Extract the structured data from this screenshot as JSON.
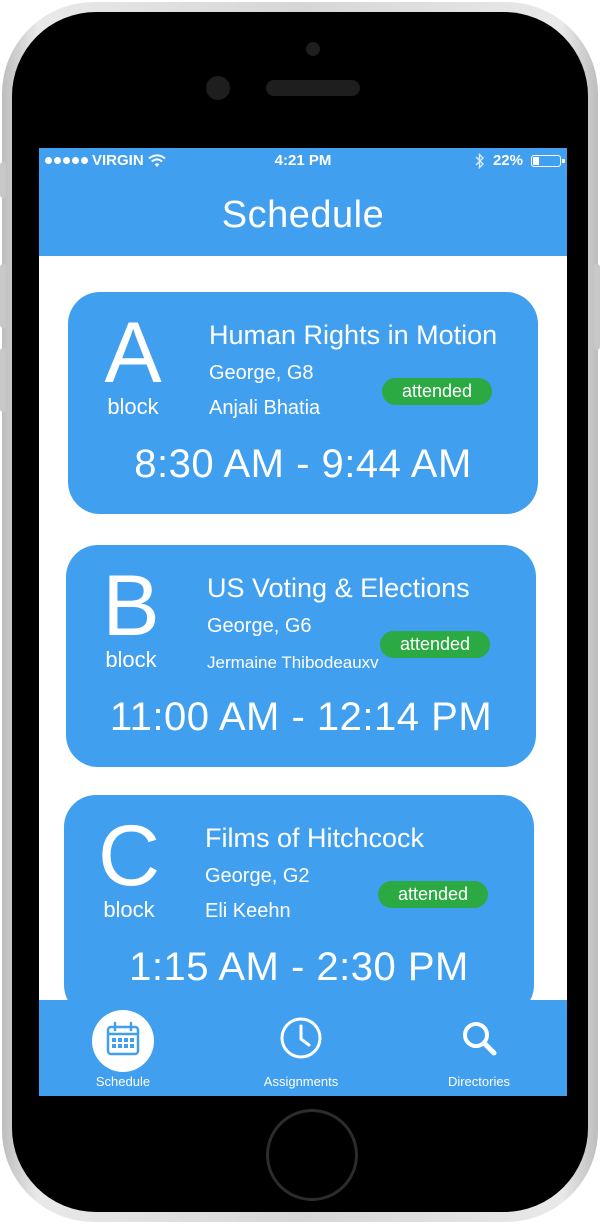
{
  "status_bar": {
    "carrier": "VIRGIN",
    "time": "4:21 PM",
    "battery": "22%",
    "wifi_icon": "wifi-icon",
    "bluetooth_icon": "bluetooth-icon"
  },
  "header": {
    "title": "Schedule"
  },
  "classes": [
    {
      "letter": "A",
      "block_label": "block",
      "course": "Human Rights in Motion",
      "room": "George, G8",
      "teacher": "Anjali Bhatia",
      "status": "attended",
      "time": "8:30 AM - 9:44 AM"
    },
    {
      "letter": "B",
      "block_label": "block",
      "course": "US Voting & Elections",
      "room": "George, G6",
      "teacher": "Jermaine Thibodeauxv",
      "status": "attended",
      "time": "11:00 AM - 12:14 PM"
    },
    {
      "letter": "C",
      "block_label": "block",
      "course": "Films of Hitchcock",
      "room": "George, G2",
      "teacher": "Eli Keehn",
      "status": "attended",
      "time": "1:15 AM - 2:30 PM"
    }
  ],
  "tabs": [
    {
      "label": "Schedule",
      "icon": "calendar-icon",
      "active": true
    },
    {
      "label": "Assignments",
      "icon": "clock-icon",
      "active": false
    },
    {
      "label": "Directories",
      "icon": "search-icon",
      "active": false
    }
  ],
  "colors": {
    "accent": "#419ff0",
    "attended": "#2ba942",
    "bezel": "#000000"
  }
}
